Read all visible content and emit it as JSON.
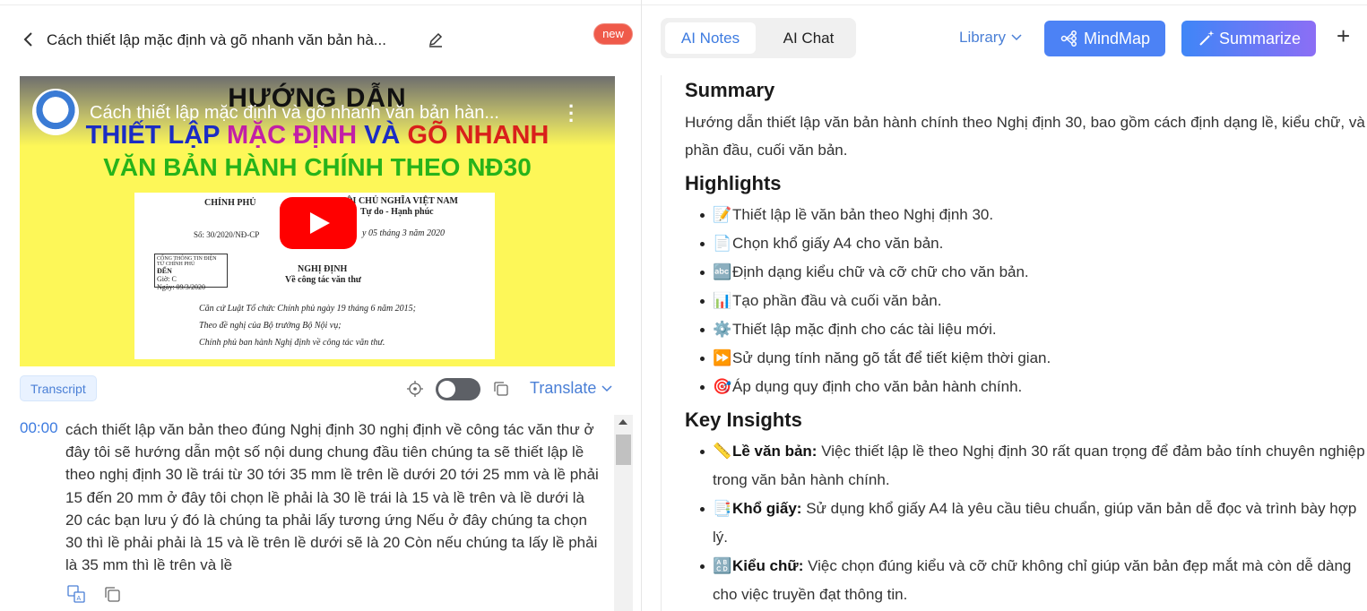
{
  "left": {
    "title": "Cách thiết lập mặc định và gõ nhanh văn bản hà...",
    "new_badge": "new",
    "video": {
      "overlay_title": "Cách thiết lập mặc định và gõ nhanh văn bản hàn...",
      "heading": "HƯỚNG DẪN",
      "line1_part1": "THIẾT LẬP",
      "line1_part2": "MẶC ĐỊNH",
      "line1_part3": "VÀ",
      "line1_part4": "GÕ NHANH",
      "line2": "VĂN BẢN HÀNH CHÍNH THEO NĐ30",
      "doc": {
        "left_header": "CHÍNH PHỦ",
        "right_header": "HỘI CHỦ NGHĨA VIỆT NAM",
        "motto": "Tự do - Hạnh phúc",
        "number": "Số: 30/2020/NĐ-CP",
        "date": "y 05 tháng 3 năm 2020",
        "stamp_line1": "CỔNG THÔNG TIN ĐIỆN TỬ CHÍNH PHỦ",
        "stamp_line2": "ĐẾN",
        "stamp_line3": "Giờ: C",
        "stamp_line4": "Ngày: 09/3/2020",
        "doc_type": "NGHỊ ĐỊNH",
        "doc_subject": "Về công tác văn thư",
        "l1": "Căn cứ Luật Tổ chức Chính phủ ngày 19 tháng 6 năm 2015;",
        "l2": "Theo đề nghị của Bộ trưởng Bộ Nội vụ;",
        "l3": "Chính phủ ban hành Nghị định về công tác văn thư."
      }
    },
    "transcript_tag": "Transcript",
    "translate_label": "Translate",
    "transcript": {
      "time": "00:00",
      "text": "cách thiết lập văn bản theo đúng Nghị định 30 nghị định về công tác văn thư ở đây tôi sẽ hướng dẫn một số nội dung chung đầu tiên chúng ta sẽ thiết lập lề theo nghị định 30 lề trái từ 30 tới 35 mm lề trên lề dưới 20 tới 25 mm và lề phải 15 đến 20 mm ở đây tôi chọn lề phải là 30 lề trái là 15 và lề trên và lề dưới là 20 các bạn lưu ý đó là chúng ta phải lấy tương ứng Nếu ở đây chúng ta chọn 30 thì lề phải phải là 15 và lề trên lề dưới sẽ là 20 Còn nếu chúng ta lấy lề phải là 35 mm thì lề trên và lề"
    }
  },
  "right": {
    "tabs": [
      "AI Notes",
      "AI Chat"
    ],
    "library_label": "Library",
    "mindmap_label": "MindMap",
    "summarize_label": "Summarize",
    "plus": "+",
    "summary_heading": "Summary",
    "summary_text": "Hướng dẫn thiết lập văn bản hành chính theo Nghị định 30, bao gồm cách định dạng lề, kiểu chữ, và phần đầu, cuối văn bản.",
    "highlights_heading": "Highlights",
    "highlights": [
      {
        "emoji": "📝",
        "text": "Thiết lập lề văn bản theo Nghị định 30."
      },
      {
        "emoji": "📄",
        "text": "Chọn khổ giấy A4 cho văn bản."
      },
      {
        "emoji": "🔤",
        "text": "Định dạng kiểu chữ và cỡ chữ cho văn bản."
      },
      {
        "emoji": "📊",
        "text": "Tạo phần đầu và cuối văn bản."
      },
      {
        "emoji": "⚙️",
        "text": "Thiết lập mặc định cho các tài liệu mới."
      },
      {
        "emoji": "⏩",
        "text": "Sử dụng tính năng gõ tắt để tiết kiệm thời gian."
      },
      {
        "emoji": "🎯",
        "text": "Áp dụng quy định cho văn bản hành chính."
      }
    ],
    "insights_heading": "Key Insights",
    "insights": [
      {
        "emoji": "📏",
        "label": "Lề văn bản:",
        "text": "Việc thiết lập lề theo Nghị định 30 rất quan trọng để đảm bảo tính chuyên nghiệp trong văn bản hành chính."
      },
      {
        "emoji": "📑",
        "label": "Khổ giấy:",
        "text": "Sử dụng khổ giấy A4 là yêu cầu tiêu chuẩn, giúp văn bản dễ đọc và trình bày hợp lý."
      },
      {
        "emoji": "🔠",
        "label": "Kiểu chữ:",
        "text": "Việc chọn đúng kiểu và cỡ chữ không chỉ giúp văn bản đẹp mắt mà còn dễ dàng cho việc truyền đạt thông tin."
      }
    ]
  }
}
